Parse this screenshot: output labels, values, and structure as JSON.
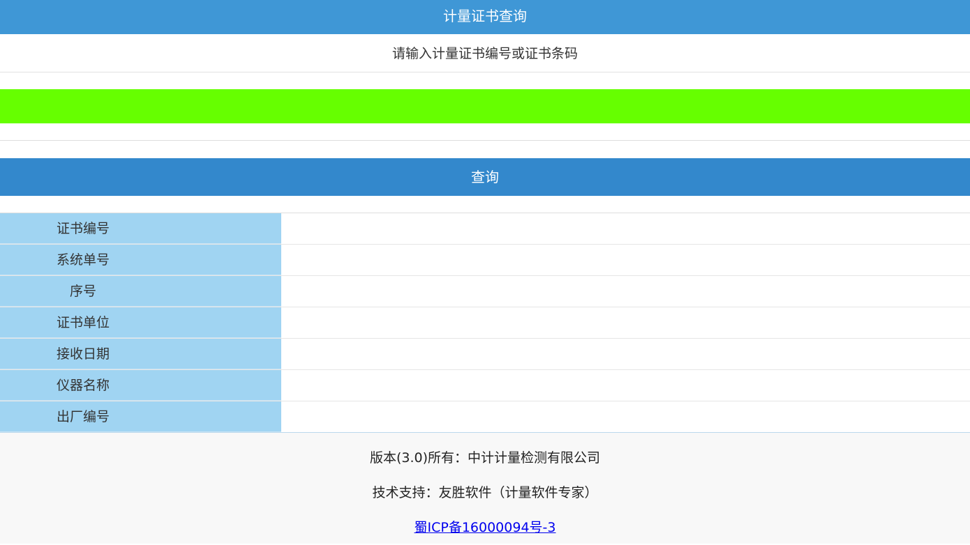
{
  "header": {
    "title": "计量证书查询"
  },
  "search": {
    "prompt": "请输入计量证书编号或证书条码",
    "input_value": "",
    "query_button_label": "查询"
  },
  "results": {
    "rows": [
      {
        "label": "证书编号",
        "value": ""
      },
      {
        "label": "系统单号",
        "value": ""
      },
      {
        "label": "序号",
        "value": ""
      },
      {
        "label": "证书单位",
        "value": ""
      },
      {
        "label": "接收日期",
        "value": ""
      },
      {
        "label": "仪器名称",
        "value": ""
      },
      {
        "label": "出厂编号",
        "value": ""
      }
    ]
  },
  "footer": {
    "copyright": "版本(3.0)所有：中计计量检测有限公司",
    "support": "技术支持：友胜软件（计量软件专家）",
    "icp_link": "蜀ICP备16000094号-3"
  },
  "colors": {
    "header_bg": "#3f97d6",
    "input_bg": "#66ff00",
    "button_bg": "#3388cc",
    "label_bg": "#a0d4f2",
    "footer_bg": "#f8f8f8",
    "link": "#0000ee"
  }
}
